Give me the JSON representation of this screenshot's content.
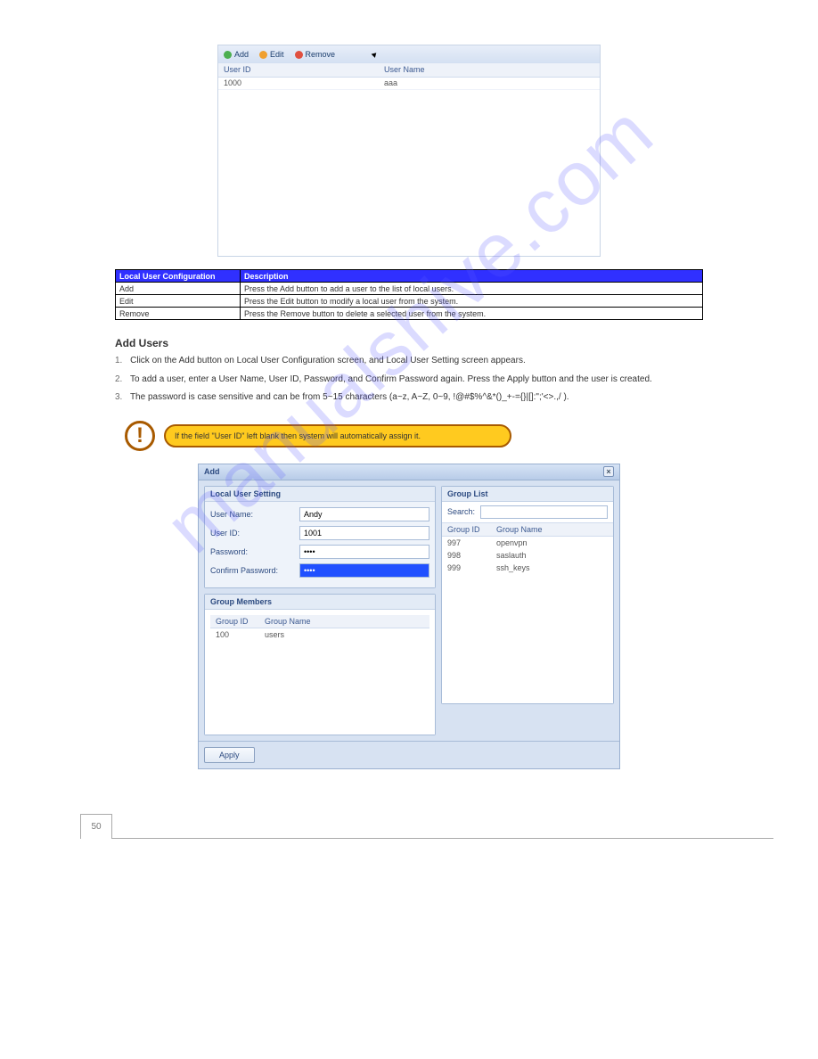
{
  "watermark": "manualshive.com",
  "screenshot1": {
    "toolbar": {
      "add": "Add",
      "edit": "Edit",
      "remove": "Remove"
    },
    "columns": {
      "user_id": "User ID",
      "user_name": "User Name"
    },
    "row": {
      "id": "1000",
      "name": "aaa"
    }
  },
  "desc_table": {
    "header": {
      "item": "Local User Configuration",
      "desc": "Description"
    },
    "rows": [
      {
        "item": "Add",
        "desc": "Press the Add button to add a user to the list of local users."
      },
      {
        "item": "Edit",
        "desc": "Press the Edit button to modify a local user from the system."
      },
      {
        "item": "Remove",
        "desc": "Press the Remove button to delete a selected user from the system."
      }
    ]
  },
  "add_user": {
    "heading": "Add Users",
    "p1": "Click on the Add button on Local User Configuration screen, and Local User Setting screen appears.",
    "p2": "To add a user, enter a User Name, User ID, Password, and Confirm Password again. Press the Apply button and the user is created.",
    "p3_a": "The password is case sensitive and can be from 5~15 characters (a~z, A~Z, 0~9, ",
    "p3_symbols": "!@#$%^&*()_+-={}|[]:\";'<>.,/",
    "p3_b": ")."
  },
  "callout": "If the field \"User ID\" left blank then system will automatically assign it.",
  "dialog": {
    "title": "Add",
    "left_panel_title": "Local User Setting",
    "labels": {
      "user_name": "User Name:",
      "user_id": "User ID:",
      "password": "Password:",
      "confirm": "Confirm Password:"
    },
    "values": {
      "user_name": "Andy",
      "user_id": "1001",
      "password": "••••",
      "confirm": "••••"
    },
    "members_title": "Group Members",
    "members_columns": {
      "gid": "Group ID",
      "gname": "Group Name"
    },
    "members_row": {
      "gid": "100",
      "gname": "users"
    },
    "right_panel_title": "Group List",
    "search_label": "Search:",
    "group_columns": {
      "gid": "Group ID",
      "gname": "Group Name"
    },
    "group_rows": [
      {
        "gid": "997",
        "gname": "openvpn"
      },
      {
        "gid": "998",
        "gname": "saslauth"
      },
      {
        "gid": "999",
        "gname": "ssh_keys"
      }
    ],
    "apply": "Apply"
  },
  "page_number": "50"
}
